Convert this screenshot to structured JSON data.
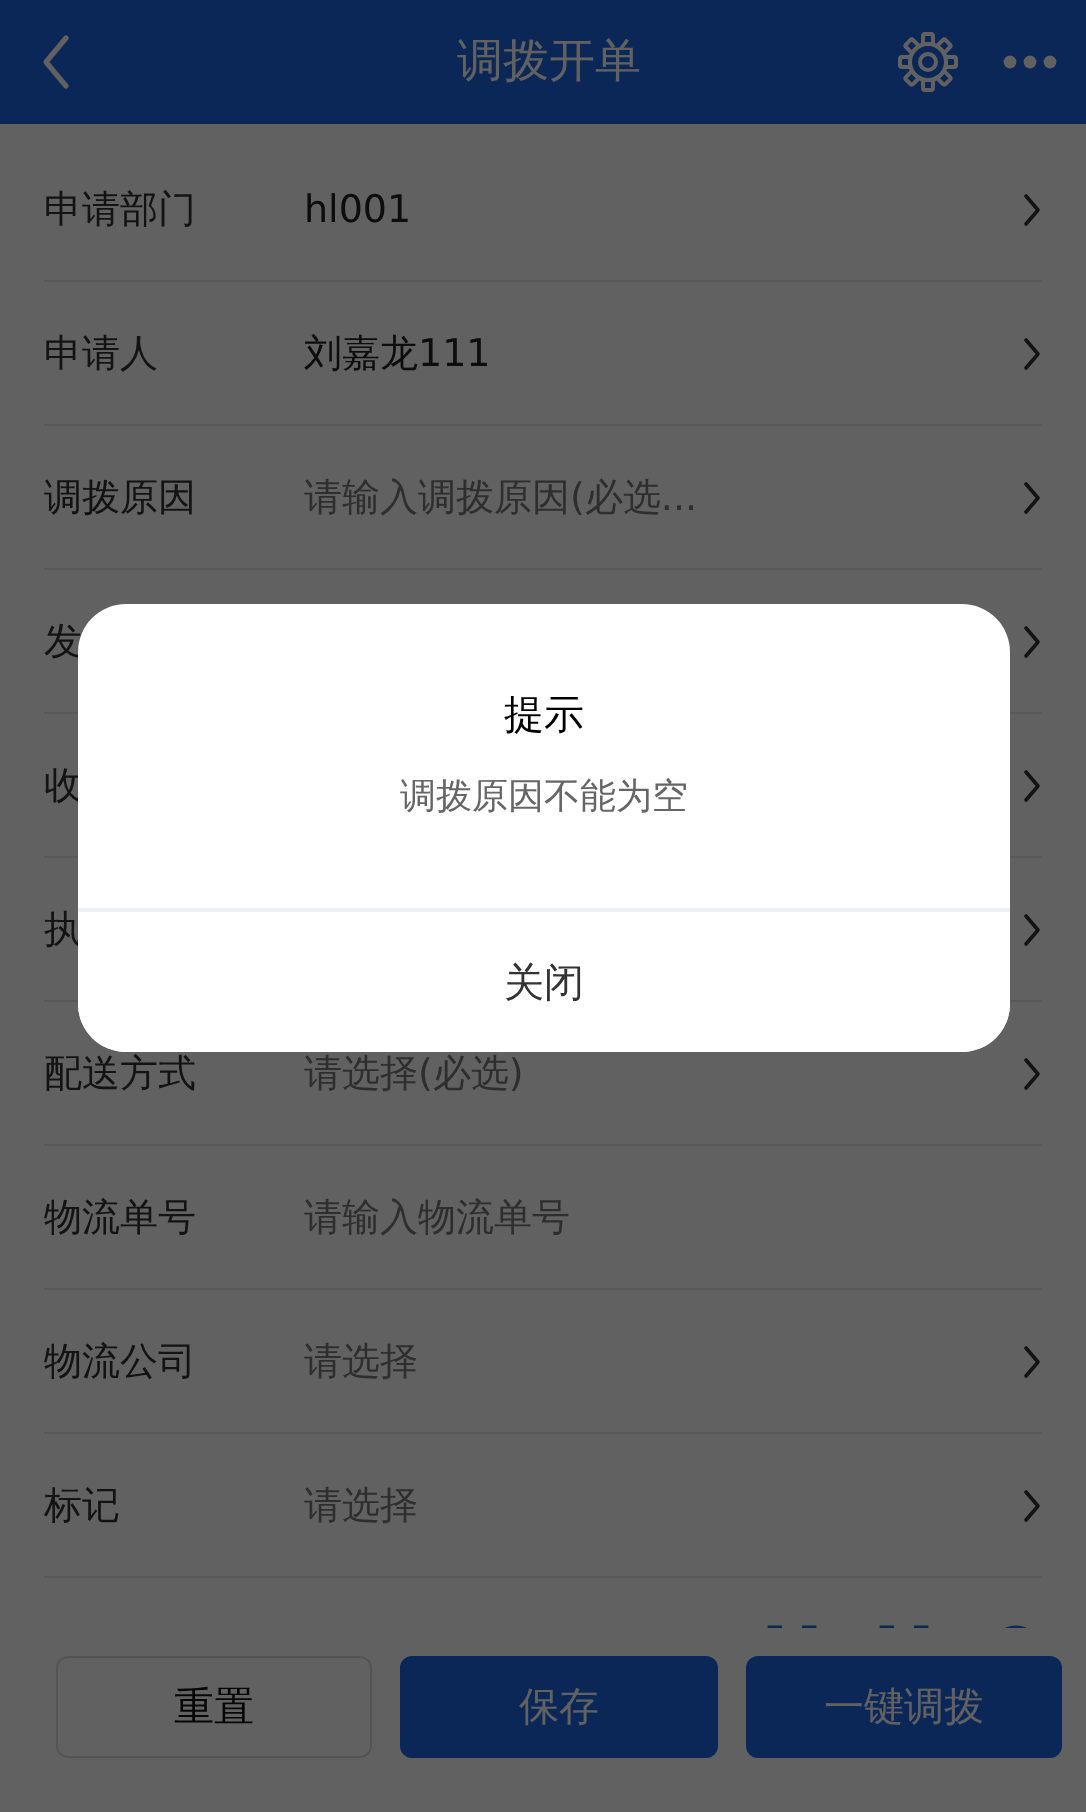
{
  "header": {
    "title": "调拨开单"
  },
  "form": [
    {
      "label": "申请部门",
      "kind": "select",
      "value": "hl001"
    },
    {
      "label": "申请人",
      "kind": "select",
      "value": "刘嘉龙111"
    },
    {
      "label": "调拨原因",
      "kind": "select",
      "placeholder": "请输入调拨原因(必选..."
    },
    {
      "label": "发",
      "kind": "select"
    },
    {
      "label": "收",
      "kind": "select"
    },
    {
      "label": "执",
      "kind": "select"
    },
    {
      "label": "配送方式",
      "kind": "select",
      "placeholder": "请选择(必选)"
    },
    {
      "label": "物流单号",
      "kind": "input",
      "placeholder": "请输入物流单号"
    },
    {
      "label": "物流公司",
      "kind": "select",
      "placeholder": "请选择"
    },
    {
      "label": "标记",
      "kind": "select",
      "placeholder": "请选择"
    },
    {
      "kind": "tools"
    }
  ],
  "footer": [
    {
      "label": "重置",
      "kind": "default"
    },
    {
      "label": "保存",
      "kind": "primary"
    },
    {
      "label": "一键调拨",
      "kind": "primary"
    }
  ],
  "dialog": {
    "title": "提示",
    "message": "调拨原因不能为空",
    "button": "关闭"
  }
}
